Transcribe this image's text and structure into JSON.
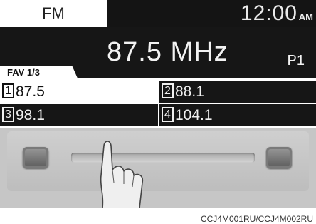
{
  "header": {
    "band": "FM",
    "time": "12:00",
    "ampm": "AM"
  },
  "tuner": {
    "frequency": "87.5 MHz",
    "preset": "P1",
    "fav_page": "FAV 1/3"
  },
  "presets": [
    {
      "num": "1",
      "freq": "87.5",
      "selected": true
    },
    {
      "num": "2",
      "freq": "88.1",
      "selected": false
    },
    {
      "num": "3",
      "freq": "98.1",
      "selected": false
    },
    {
      "num": "4",
      "freq": "104.1",
      "selected": false
    }
  ],
  "caption": "CCJ4M001RU/CCJ4M002RU",
  "colors": {
    "screen_dark": "#161616",
    "screen_light": "#ffffff",
    "photo_bg": "#c6c6c6"
  },
  "icons": {
    "hand": "pointing-hand-icon"
  }
}
